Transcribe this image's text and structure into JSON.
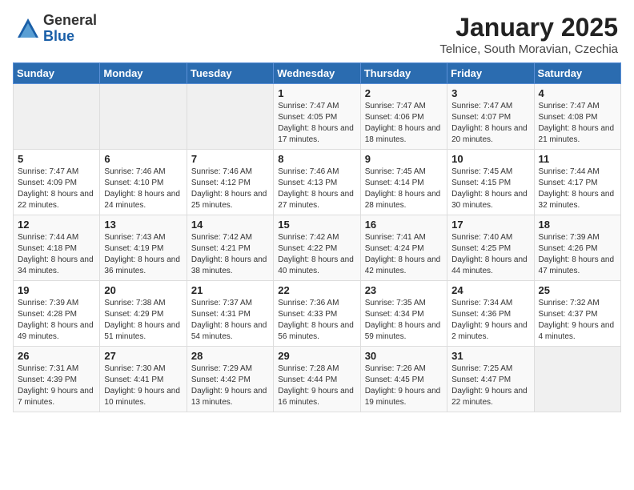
{
  "header": {
    "logo_general": "General",
    "logo_blue": "Blue",
    "month_title": "January 2025",
    "subtitle": "Telnice, South Moravian, Czechia"
  },
  "weekdays": [
    "Sunday",
    "Monday",
    "Tuesday",
    "Wednesday",
    "Thursday",
    "Friday",
    "Saturday"
  ],
  "weeks": [
    [
      {
        "day": "",
        "sunrise": "",
        "sunset": "",
        "daylight": ""
      },
      {
        "day": "",
        "sunrise": "",
        "sunset": "",
        "daylight": ""
      },
      {
        "day": "",
        "sunrise": "",
        "sunset": "",
        "daylight": ""
      },
      {
        "day": "1",
        "sunrise": "Sunrise: 7:47 AM",
        "sunset": "Sunset: 4:05 PM",
        "daylight": "Daylight: 8 hours and 17 minutes."
      },
      {
        "day": "2",
        "sunrise": "Sunrise: 7:47 AM",
        "sunset": "Sunset: 4:06 PM",
        "daylight": "Daylight: 8 hours and 18 minutes."
      },
      {
        "day": "3",
        "sunrise": "Sunrise: 7:47 AM",
        "sunset": "Sunset: 4:07 PM",
        "daylight": "Daylight: 8 hours and 20 minutes."
      },
      {
        "day": "4",
        "sunrise": "Sunrise: 7:47 AM",
        "sunset": "Sunset: 4:08 PM",
        "daylight": "Daylight: 8 hours and 21 minutes."
      }
    ],
    [
      {
        "day": "5",
        "sunrise": "Sunrise: 7:47 AM",
        "sunset": "Sunset: 4:09 PM",
        "daylight": "Daylight: 8 hours and 22 minutes."
      },
      {
        "day": "6",
        "sunrise": "Sunrise: 7:46 AM",
        "sunset": "Sunset: 4:10 PM",
        "daylight": "Daylight: 8 hours and 24 minutes."
      },
      {
        "day": "7",
        "sunrise": "Sunrise: 7:46 AM",
        "sunset": "Sunset: 4:12 PM",
        "daylight": "Daylight: 8 hours and 25 minutes."
      },
      {
        "day": "8",
        "sunrise": "Sunrise: 7:46 AM",
        "sunset": "Sunset: 4:13 PM",
        "daylight": "Daylight: 8 hours and 27 minutes."
      },
      {
        "day": "9",
        "sunrise": "Sunrise: 7:45 AM",
        "sunset": "Sunset: 4:14 PM",
        "daylight": "Daylight: 8 hours and 28 minutes."
      },
      {
        "day": "10",
        "sunrise": "Sunrise: 7:45 AM",
        "sunset": "Sunset: 4:15 PM",
        "daylight": "Daylight: 8 hours and 30 minutes."
      },
      {
        "day": "11",
        "sunrise": "Sunrise: 7:44 AM",
        "sunset": "Sunset: 4:17 PM",
        "daylight": "Daylight: 8 hours and 32 minutes."
      }
    ],
    [
      {
        "day": "12",
        "sunrise": "Sunrise: 7:44 AM",
        "sunset": "Sunset: 4:18 PM",
        "daylight": "Daylight: 8 hours and 34 minutes."
      },
      {
        "day": "13",
        "sunrise": "Sunrise: 7:43 AM",
        "sunset": "Sunset: 4:19 PM",
        "daylight": "Daylight: 8 hours and 36 minutes."
      },
      {
        "day": "14",
        "sunrise": "Sunrise: 7:42 AM",
        "sunset": "Sunset: 4:21 PM",
        "daylight": "Daylight: 8 hours and 38 minutes."
      },
      {
        "day": "15",
        "sunrise": "Sunrise: 7:42 AM",
        "sunset": "Sunset: 4:22 PM",
        "daylight": "Daylight: 8 hours and 40 minutes."
      },
      {
        "day": "16",
        "sunrise": "Sunrise: 7:41 AM",
        "sunset": "Sunset: 4:24 PM",
        "daylight": "Daylight: 8 hours and 42 minutes."
      },
      {
        "day": "17",
        "sunrise": "Sunrise: 7:40 AM",
        "sunset": "Sunset: 4:25 PM",
        "daylight": "Daylight: 8 hours and 44 minutes."
      },
      {
        "day": "18",
        "sunrise": "Sunrise: 7:39 AM",
        "sunset": "Sunset: 4:26 PM",
        "daylight": "Daylight: 8 hours and 47 minutes."
      }
    ],
    [
      {
        "day": "19",
        "sunrise": "Sunrise: 7:39 AM",
        "sunset": "Sunset: 4:28 PM",
        "daylight": "Daylight: 8 hours and 49 minutes."
      },
      {
        "day": "20",
        "sunrise": "Sunrise: 7:38 AM",
        "sunset": "Sunset: 4:29 PM",
        "daylight": "Daylight: 8 hours and 51 minutes."
      },
      {
        "day": "21",
        "sunrise": "Sunrise: 7:37 AM",
        "sunset": "Sunset: 4:31 PM",
        "daylight": "Daylight: 8 hours and 54 minutes."
      },
      {
        "day": "22",
        "sunrise": "Sunrise: 7:36 AM",
        "sunset": "Sunset: 4:33 PM",
        "daylight": "Daylight: 8 hours and 56 minutes."
      },
      {
        "day": "23",
        "sunrise": "Sunrise: 7:35 AM",
        "sunset": "Sunset: 4:34 PM",
        "daylight": "Daylight: 8 hours and 59 minutes."
      },
      {
        "day": "24",
        "sunrise": "Sunrise: 7:34 AM",
        "sunset": "Sunset: 4:36 PM",
        "daylight": "Daylight: 9 hours and 2 minutes."
      },
      {
        "day": "25",
        "sunrise": "Sunrise: 7:32 AM",
        "sunset": "Sunset: 4:37 PM",
        "daylight": "Daylight: 9 hours and 4 minutes."
      }
    ],
    [
      {
        "day": "26",
        "sunrise": "Sunrise: 7:31 AM",
        "sunset": "Sunset: 4:39 PM",
        "daylight": "Daylight: 9 hours and 7 minutes."
      },
      {
        "day": "27",
        "sunrise": "Sunrise: 7:30 AM",
        "sunset": "Sunset: 4:41 PM",
        "daylight": "Daylight: 9 hours and 10 minutes."
      },
      {
        "day": "28",
        "sunrise": "Sunrise: 7:29 AM",
        "sunset": "Sunset: 4:42 PM",
        "daylight": "Daylight: 9 hours and 13 minutes."
      },
      {
        "day": "29",
        "sunrise": "Sunrise: 7:28 AM",
        "sunset": "Sunset: 4:44 PM",
        "daylight": "Daylight: 9 hours and 16 minutes."
      },
      {
        "day": "30",
        "sunrise": "Sunrise: 7:26 AM",
        "sunset": "Sunset: 4:45 PM",
        "daylight": "Daylight: 9 hours and 19 minutes."
      },
      {
        "day": "31",
        "sunrise": "Sunrise: 7:25 AM",
        "sunset": "Sunset: 4:47 PM",
        "daylight": "Daylight: 9 hours and 22 minutes."
      },
      {
        "day": "",
        "sunrise": "",
        "sunset": "",
        "daylight": ""
      }
    ]
  ]
}
